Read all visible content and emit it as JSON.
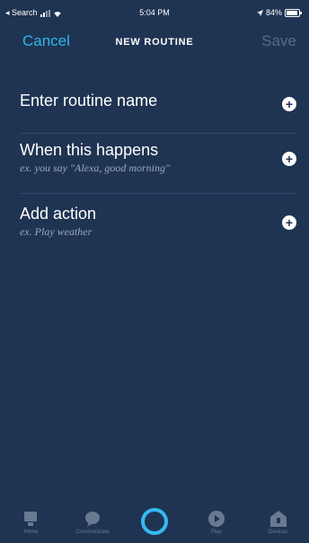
{
  "status_bar": {
    "back_label": "◂ Search",
    "time": "5:04 PM",
    "battery_text": "84%"
  },
  "nav": {
    "cancel_label": "Cancel",
    "title": "NEW ROUTINE",
    "save_label": "Save"
  },
  "rows": [
    {
      "label": "Enter routine name",
      "sub": ""
    },
    {
      "label": "When this happens",
      "sub": "ex. you say \"Alexa, good morning\""
    },
    {
      "label": "Add action",
      "sub": "ex. Play weather"
    }
  ],
  "tabs": [
    {
      "label": "Home",
      "icon": "home-icon"
    },
    {
      "label": "Communicate",
      "icon": "chat-bubble-icon"
    },
    {
      "label": "",
      "icon": "alexa-ring-icon"
    },
    {
      "label": "Play",
      "icon": "play-icon"
    },
    {
      "label": "Devices",
      "icon": "devices-icon"
    }
  ],
  "colors": {
    "background": "#1f3452",
    "accent": "#2fb7e6",
    "disabled": "#566b86",
    "alexa_ring": "#35b9f0"
  }
}
